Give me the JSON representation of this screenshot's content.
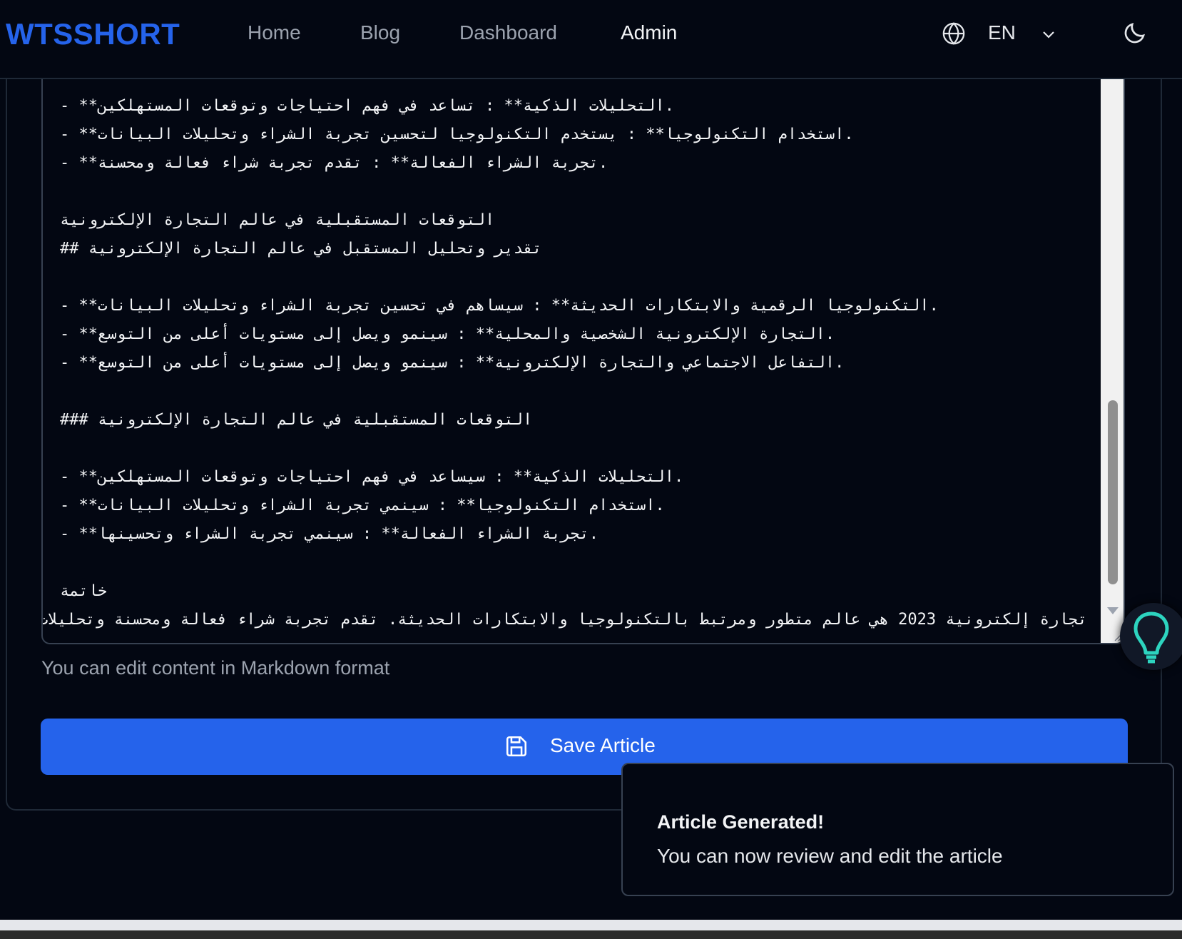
{
  "brand": "WTSSHORT",
  "nav": {
    "home": "Home",
    "blog": "Blog",
    "dashboard": "Dashboard",
    "admin": "Admin",
    "language": "EN",
    "globe_icon": "globe-icon",
    "chevron_icon": "chevron-down-icon",
    "theme_icon": "moon-icon"
  },
  "editor": {
    "lines": [
      "- **التحليلات الذكية** : تساعد في فهم احتياجات وتوقعات المستهلكين.",
      "- **استخدام التكنولوجيا** : يستخدم التكنولوجيا لتحسين تجربة الشراء وتحليلات البيانات.",
      "- **تجربة الشراء الفعالة** : تقدم تجربة شراء فعالة ومحسنة.",
      "",
      "التوقعات المستقبلية في عالم التجارة الإلكترونية",
      "## تقدير وتحليل المستقبل في عالم التجارة الإلكترونية",
      "",
      "- **التكنولوجيا الرقمية والابتكارات الحديثة** : سيساهم في تحسين تجربة الشراء وتحليلات البيانات.",
      "- **التجارة الإلكترونية الشخصية والمحلية** : سينمو ويصل إلى مستويات أعلى من التوسع.",
      "- **التفاعل الاجتماعي والتجارة الإلكترونية** : سينمو ويصل إلى مستويات أعلى من التوسع.",
      "",
      "### التوقعات المستقبلية في عالم التجارة الإلكترونية",
      "",
      "- **التحليلات الذكية** : سيساعد في فهم احتياجات وتوقعات المستهلكين.",
      "- **استخدام التكنولوجيا** : سينمي تجربة الشراء وتحليلات البيانات.",
      "- **تجربة الشراء الفعالة** : سينمي تجربة الشراء وتحسينها.",
      "",
      "خاتمة",
      "تجارة إلكترونية 2023 هي عالم متطور ومرتبط بالتكنولوجيا والابتكارات الحديثة. تقدم تجربة شراء فعالة ومحسنة وتحليلات ذكية. تسعى إلى"
    ],
    "scroll_fraction": 0.75
  },
  "helper_text": "You can edit content in Markdown format",
  "save_button": {
    "label": "Save Article",
    "icon": "save-icon"
  },
  "toast": {
    "title": "Article Generated!",
    "description": "You can now review and edit the article"
  },
  "floating_button": {
    "icon": "lightbulb-icon",
    "color": "#2dd4bf"
  },
  "colors": {
    "brand": "#2563eb",
    "background": "#030712",
    "accent": "#2563eb"
  }
}
